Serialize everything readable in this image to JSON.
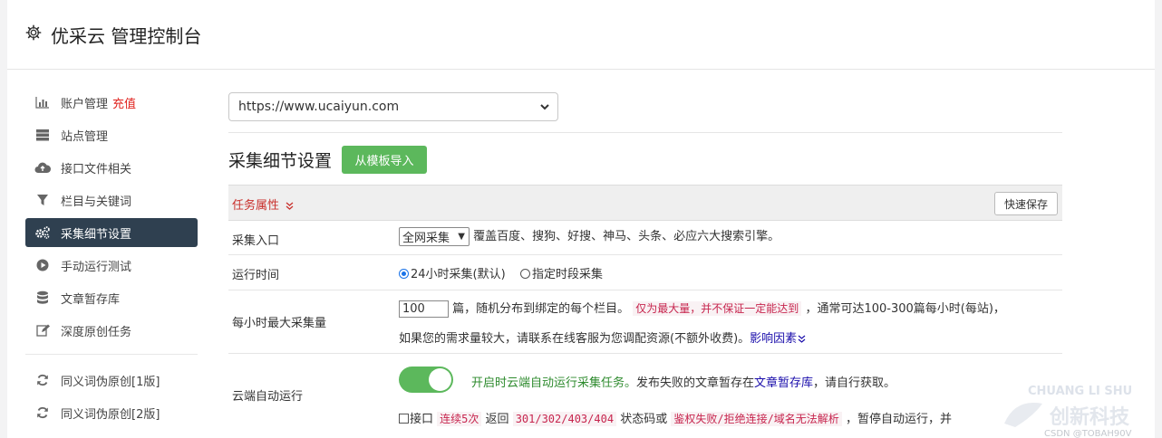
{
  "header": {
    "title": "优采云 管理控制台"
  },
  "sidebar": {
    "items": [
      {
        "label": "账户管理",
        "badge": "充值",
        "icon": "bar-chart-icon"
      },
      {
        "label": "站点管理",
        "icon": "server-icon"
      },
      {
        "label": "接口文件相关",
        "icon": "cloud-upload-icon"
      },
      {
        "label": "栏目与关键词",
        "icon": "filter-icon"
      },
      {
        "label": "采集细节设置",
        "icon": "cogs-icon",
        "active": true
      },
      {
        "label": "手动运行测试",
        "icon": "play-circle-icon"
      },
      {
        "label": "文章暂存库",
        "icon": "database-icon"
      },
      {
        "label": "深度原创任务",
        "icon": "edit-icon"
      }
    ],
    "items2": [
      {
        "label": "同义词伪原创[1版]",
        "icon": "refresh-icon"
      },
      {
        "label": "同义词伪原创[2版]",
        "icon": "refresh-icon"
      }
    ]
  },
  "main": {
    "site_select": "https://www.ucaiyun.com",
    "section_title": "采集细节设置",
    "import_button": "从模板导入",
    "task_attr_label": "任务属性",
    "quick_save": "快速保存",
    "rows": {
      "entry": {
        "label": "采集入口",
        "select_value": "全网采集",
        "desc": "覆盖百度、搜狗、好搜、神马、头条、必应六大搜索引擎。"
      },
      "runtime": {
        "label": "运行时间",
        "opt1": "24小时采集(默认)",
        "opt2": "指定时段采集"
      },
      "max": {
        "label": "每小时最大采集量",
        "value": "100",
        "text1": "篇，随机分布到绑定的每个栏目。",
        "red_note": "仅为最大量，并不保证一定能达到",
        "text2": "，通常可达100-300篇每小时(每站)，",
        "text3": "如果您的需求量较大，请联系在线客服为您调配资源(不额外收费)。",
        "link": "影响因素"
      },
      "cloud": {
        "label": "云端自动运行",
        "green_text": "开启时云端自动运行采集任务。",
        "text1": "发布失败的文章暂存在",
        "link": "文章暂存库",
        "text2": "，请自行获取。",
        "chk_label": "接口",
        "code1": "连续5次",
        "t1": "返回",
        "code2": "301/302/403/404",
        "t2": "状态码或",
        "code3": "鉴权失败/拒绝连接/域名无法解析",
        "t3": "，暂停自动运行，并"
      }
    }
  },
  "watermark": {
    "line1": "CHUANG LI SHU",
    "line2": "创新科技",
    "line3": "CSDN @TOBAH90V"
  },
  "colors": {
    "sidebar_active": "#2f4050",
    "green": "#5cb85c",
    "red": "#e0221e"
  }
}
